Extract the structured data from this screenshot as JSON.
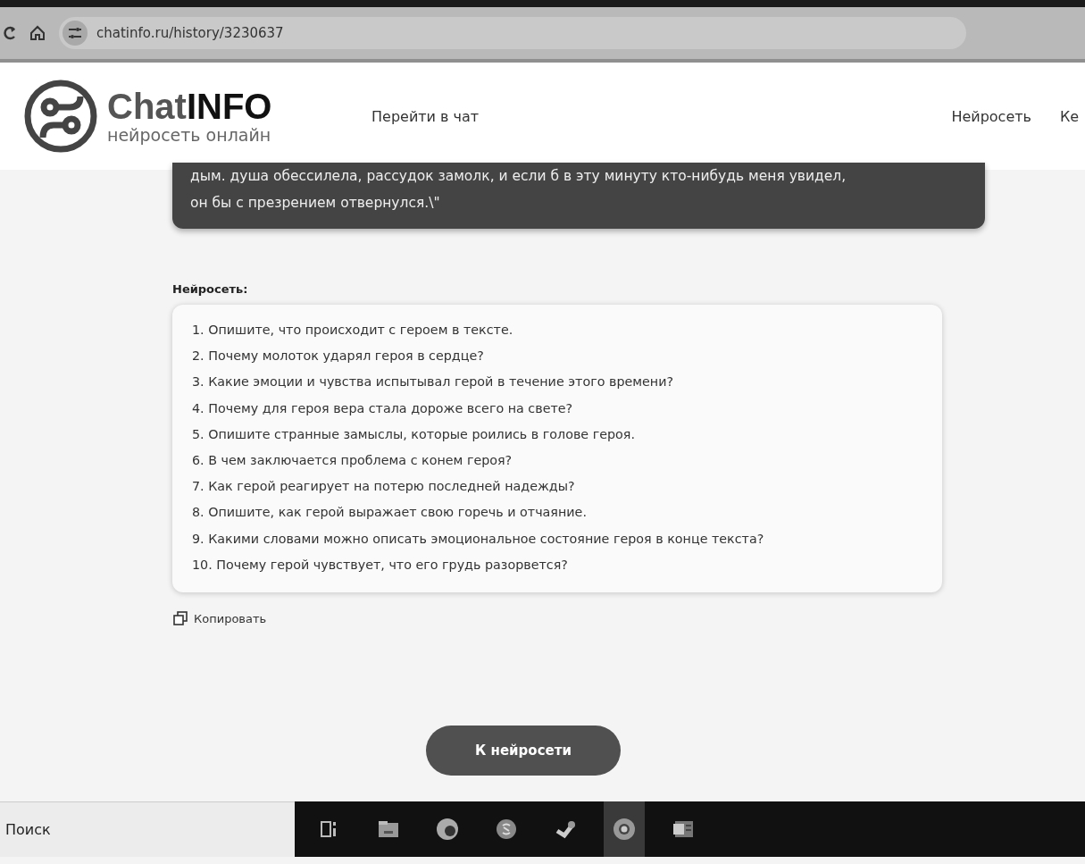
{
  "browser": {
    "url": "chatinfo.ru/history/3230637"
  },
  "header": {
    "logo_title_part_1": "Chat",
    "logo_title_part_2": "INFO",
    "logo_subtitle": "нейросеть онлайн",
    "nav": [
      {
        "label": "Перейти в чат"
      },
      {
        "label": "Нейросеть"
      },
      {
        "label": "Ке"
      }
    ]
  },
  "user_message": {
    "lines": [
      "дым. душа обессилела, рассудок замолк, и если б в эту минуту кто-нибудь меня увидел,",
      "он бы с презрением отвернулся.\\\""
    ]
  },
  "answer": {
    "label": "Нейросеть:",
    "items": [
      "1. Опишите, что происходит с героем в тексте.",
      "2. Почему молоток ударял героя в сердце?",
      "3. Какие эмоции и чувства испытывал герой в течение этого времени?",
      "4. Почему для героя вера стала дороже всего на свете?",
      "5. Опишите странные замыслы, которые роились в голове героя.",
      "6. В чем заключается проблема с конем героя?",
      "7. Как герой реагирует на потерю последней надежды?",
      "8. Опишите, как герой выражает свою горечь и отчаяние.",
      "9. Какими словами можно описать эмоциональное состояние героя в конце текста?",
      "10. Почему герой чувствует, что его грудь разорвется?"
    ],
    "copy_label": "Копировать"
  },
  "main_button": "К нейросети",
  "taskbar": {
    "search_placeholder": "Поиск",
    "apps": [
      {
        "kind": "taskview",
        "selected": false
      },
      {
        "kind": "folder",
        "selected": false
      },
      {
        "kind": "edge",
        "selected": false
      },
      {
        "kind": "skype",
        "selected": false
      },
      {
        "kind": "steam",
        "selected": false
      },
      {
        "kind": "chrome",
        "selected": true
      },
      {
        "kind": "word",
        "selected": false
      }
    ]
  }
}
